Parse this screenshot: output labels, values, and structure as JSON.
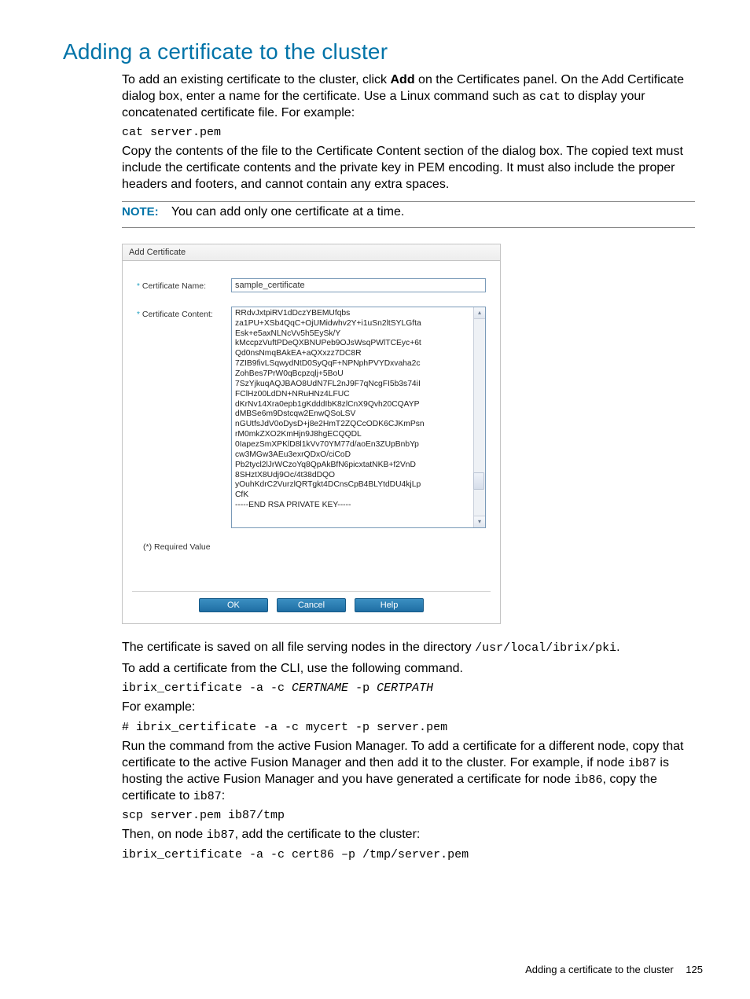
{
  "title": "Adding a certificate to the cluster",
  "intro": {
    "p1a": "To add an existing certificate to the cluster, click ",
    "p1b": "Add",
    "p1c": " on the Certificates panel. On the Add Certificate dialog box, enter a name for the certificate. Use a Linux command such as ",
    "p1d": "cat",
    "p1e": " to display your concatenated certificate file. For example:"
  },
  "cmd1": "cat server.pem",
  "copy_para": "Copy the contents of the file to the Certificate Content section of the dialog box. The copied text must include the certificate contents and the private key in PEM encoding. It must also include the proper headers and footers, and cannot contain any extra spaces.",
  "note_label": "NOTE:",
  "note_text": "You can add only one certificate at a time.",
  "dialog": {
    "title": "Add Certificate",
    "name_label": "Certificate Name:",
    "name_value": "sample_certificate",
    "content_label": "Certificate Content:",
    "content_value": "RRdvJxtpiRV1dDczYBEMUfqbs\nza1PU+XSb4QqC+OjUMidwhv2Y+i1uSn2ltSYLGfta\nEsk+e5axNLNcVv5h5EySk/Y\nkMccpzVuftPDeQXBNUPeb9OJsWsqPWlTCEyc+6t\nQd0nsNmqBAkEA+aQXxzz7DC8R\n7ZIB9fivLSqwydNtD0SyQqF+NPNphPVYDxvaha2c\nZohBes7PrW0qBcpzqlj+5BoU\n7SzYjkuqAQJBAO8UdN7FL2nJ9F7qNcgFI5b3s74iI\nFClHz00LdDN+NRuHNz4LFUC\ndKrNv14Xra0epb1gKdddIbK8zlCnX9Qvh20CQAYP\ndMBSe6m9Dstcqw2EnwQSoLSV\nnGUtfsJdV0oDysD+j8e2HmT2ZQCcODK6CJKmPsn\nrM0mkZXO2KmHjn9J8hgECQQDL\n0IapezSmXPKlD8l1kVv70YM77d/aoEn3ZUpBnbYp\ncw3MGw3AEu3exrQDxO/ciCoD\nPb2tycl2lJrWCzoYq8QpAkBfN6picxtatNKB+f2VnD\n8SHztX8Udj9Oc/4t38dDQO\nyOuhKdrC2VurzlQRTgkt4DCnsCpB4BLYtdDU4kjLp\nCfK\n-----END RSA PRIVATE KEY-----",
    "required": "(*) Required Value",
    "ok": "OK",
    "cancel": "Cancel",
    "help": "Help"
  },
  "after": {
    "saved_a": "The certificate is saved on all file serving nodes in the directory ",
    "saved_b": "/usr/local/ibrix/pki",
    "saved_c": ".",
    "cli_intro": "To add a certificate from the CLI, use the following command.",
    "cli_cmd_a": "ibrix_certificate -a -c ",
    "cli_cmd_b": "CERTNAME",
    "cli_cmd_c": " -p ",
    "cli_cmd_d": "CERTPATH",
    "for_example": "For example:",
    "example_cmd": "# ibrix_certificate -a -c mycert -p server.pem",
    "run_a": "Run the command from the active Fusion Manager. To add a certificate for a different node, copy that certificate to the active Fusion Manager and then add it to the cluster. For example, if node ",
    "run_b": "ib87",
    "run_c": " is hosting the active Fusion Manager and you have generated a certificate for node ",
    "run_d": "ib86",
    "run_e": ", copy the certificate to ",
    "run_f": "ib87",
    "run_g": ":",
    "scp": "scp server.pem ib87/tmp",
    "then_a": "Then, on node ",
    "then_b": "ib87",
    "then_c": ", add the certificate to the cluster:",
    "final_cmd": "ibrix_certificate -a -c cert86 –p /tmp/server.pem"
  },
  "footer": {
    "text": "Adding a certificate to the cluster",
    "page": "125"
  }
}
